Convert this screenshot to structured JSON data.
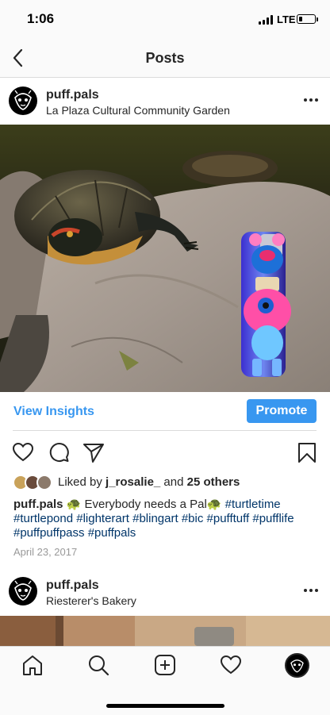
{
  "status_bar": {
    "time": "1:06",
    "network": "LTE",
    "battery_level": 0.2
  },
  "nav": {
    "title": "Posts",
    "back_icon": "chevron-left-icon"
  },
  "post1": {
    "username": "puff.pals",
    "location": "La Plaza Cultural Community Garden",
    "more_icon": "ellipsis-icon",
    "image_icon": "photo-turtle-lighter",
    "insights_label": "View Insights",
    "promote_label": "Promote",
    "actions": {
      "like_icon": "heart-icon",
      "comment_icon": "comment-icon",
      "share_icon": "send-icon",
      "save_icon": "bookmark-icon"
    },
    "likes": {
      "prefix": "Liked by ",
      "user": "j_rosalie_",
      "middle": " and ",
      "count": "25 others"
    },
    "caption": {
      "user": "puff.pals",
      "text": " 🐢 Everybody needs a Pal🐢 ",
      "tags": [
        "#turtletime",
        "#turtlepond",
        "#lighterart",
        "#blingart",
        "#bic",
        "#pufftuff",
        "#pufflife",
        "#puffpuffpass",
        "#puffpals"
      ]
    },
    "date": "April 23, 2017"
  },
  "post2": {
    "username": "puff.pals",
    "location": "Riesterer's Bakery",
    "more_icon": "ellipsis-icon"
  },
  "tab_bar": {
    "icons": [
      "home-icon",
      "search-icon",
      "new-post-icon",
      "activity-heart-icon",
      "profile-avatar"
    ]
  },
  "colors": {
    "accent": "#3897f0",
    "hashtag": "#003569",
    "muted": "#999999",
    "text": "#262626"
  }
}
